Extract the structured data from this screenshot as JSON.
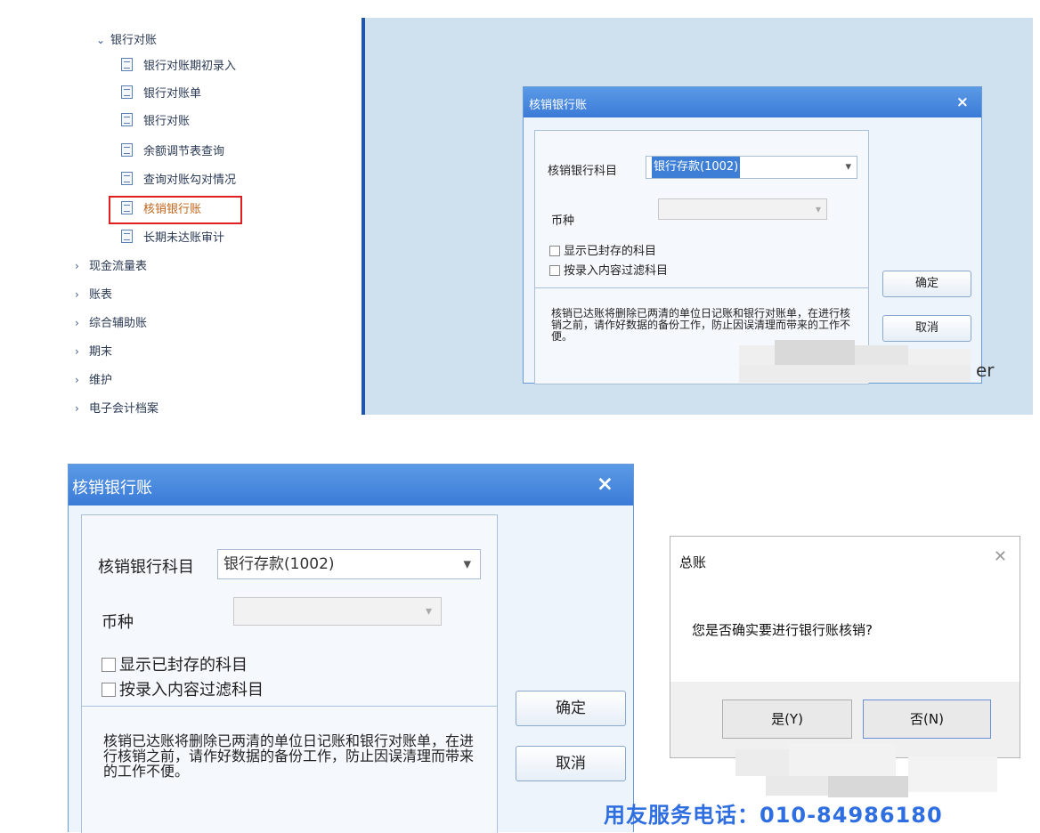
{
  "top": {
    "tree": {
      "group_label": "银行对账",
      "items": [
        "银行对账期初录入",
        "银行对账单",
        "银行对账",
        "余额调节表查询",
        "查询对账勾对情况",
        "核销银行账",
        "长期未达账审计"
      ],
      "sections": [
        "现金流量表",
        "账表",
        "综合辅助账",
        "期末",
        "维护",
        "电子会计档案"
      ]
    },
    "dialog": {
      "title": "核销银行账",
      "close": "×",
      "account_label": "核销银行科目",
      "account_value": "银行存款(1002)",
      "currency_label": "币种",
      "checkbox_sealed": "显示已封存的科目",
      "checkbox_filter": "按录入内容过滤科目",
      "ok_label": "确定",
      "cancel_label": "取消",
      "note": "核销已达账将删除已两清的单位日记账和银行对账单，在进行核销之前，请作好数据的备份工作，防止因误清理而带来的工作不便。"
    },
    "partial_text": "er"
  },
  "bottom": {
    "dialog": {
      "title": "核销银行账",
      "close": "×",
      "account_label": "核销银行科目",
      "account_value": "银行存款(1002)",
      "currency_label": "币种",
      "checkbox_sealed": "显示已封存的科目",
      "checkbox_filter": "按录入内容过滤科目",
      "ok_label": "确定",
      "cancel_label": "取消",
      "note": "核销已达账将删除已两清的单位日记账和银行对账单，在进行核销之前，请作好数据的备份工作，防止因误清理而带来的工作不便。"
    },
    "confirm": {
      "title": "总账",
      "close": "✕",
      "message": "您是否确实要进行银行账核销?",
      "yes_label": "是(Y)",
      "no_label": "否(N)"
    },
    "service_phone": "用友服务电话：010-84986180"
  },
  "colors": {
    "title_bar": "#3b7bd7",
    "tree_divider": "#1f56a8",
    "workspace": "#cfe0ef",
    "highlight": "#e02020",
    "service_text": "#2f6ee0",
    "selected_item_text": "#c0651a"
  }
}
